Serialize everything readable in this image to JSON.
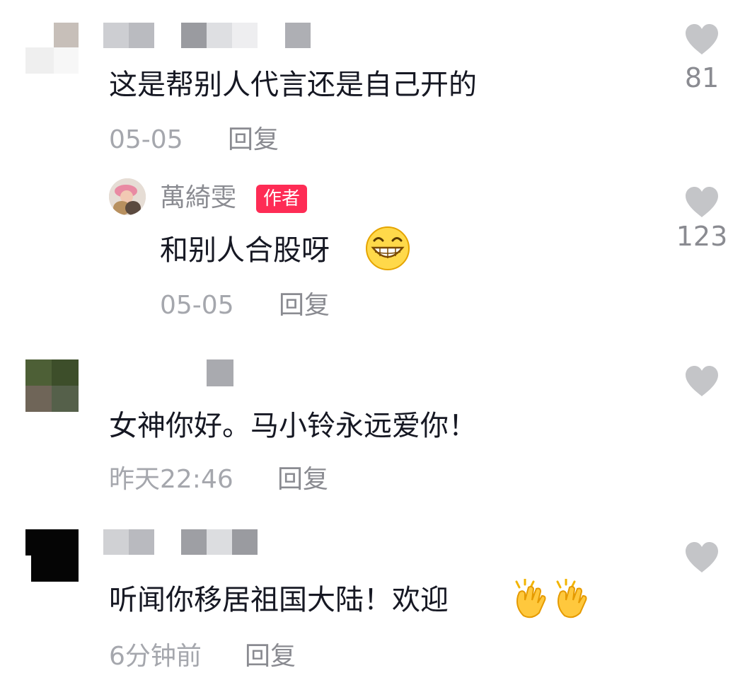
{
  "comments": [
    {
      "text": "这是帮别人代言还是自己开的",
      "time": "05-05",
      "reply_label": "回复",
      "like_count": "81"
    },
    {
      "author_name": "萬綺雯",
      "author_badge": "作者",
      "text": "和别人合股呀",
      "time": "05-05",
      "reply_label": "回复",
      "like_count": "123",
      "emoji": "grinning-face"
    },
    {
      "text": "女神你好。马小铃永远爱你！",
      "time": "昨天22:46",
      "reply_label": "回复",
      "like_count": ""
    },
    {
      "text": "听闻你移居祖国大陆！欢迎",
      "time": "6分钟前",
      "reply_label": "回复",
      "like_count": "",
      "emoji": "clapping-hands"
    }
  ],
  "colors": {
    "text": "#161823",
    "meta": "#a5a7ad",
    "heart": "#c4c5c8",
    "badge": "#fe2c55"
  },
  "icons": [
    "heart-icon",
    "avatar",
    "grinning-face-emoji",
    "clapping-hands-emoji"
  ]
}
